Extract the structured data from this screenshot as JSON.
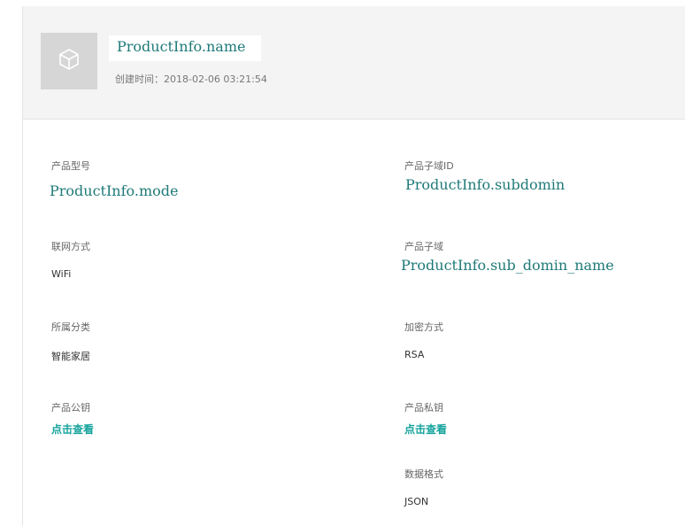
{
  "header": {
    "product_name": "ProductInfo.name",
    "created_label": "创建时间：",
    "created_value": "2018-02-06 03:21:54",
    "thumbnail_icon": "cube-icon"
  },
  "fields": {
    "model": {
      "label": "产品型号",
      "value": "ProductInfo.mode"
    },
    "subdomain_id": {
      "label": "产品子域ID",
      "value": "ProductInfo.subdomin"
    },
    "network": {
      "label": "联网方式",
      "value": "WiFi"
    },
    "subdomain": {
      "label": "产品子域",
      "value": "ProductInfo.sub_domin_name"
    },
    "category": {
      "label": "所属分类",
      "value": "智能家居"
    },
    "encryption": {
      "label": "加密方式",
      "value": "RSA"
    },
    "public_key": {
      "label": "产品公钥",
      "link": "点击查看"
    },
    "private_key": {
      "label": "产品私钥",
      "link": "点击查看"
    },
    "data_format": {
      "label": "数据格式",
      "value": "JSON"
    }
  },
  "colors": {
    "accent": "#14a39c",
    "placeholder_text": "#1f7a79",
    "header_bg": "#f4f4f4"
  }
}
